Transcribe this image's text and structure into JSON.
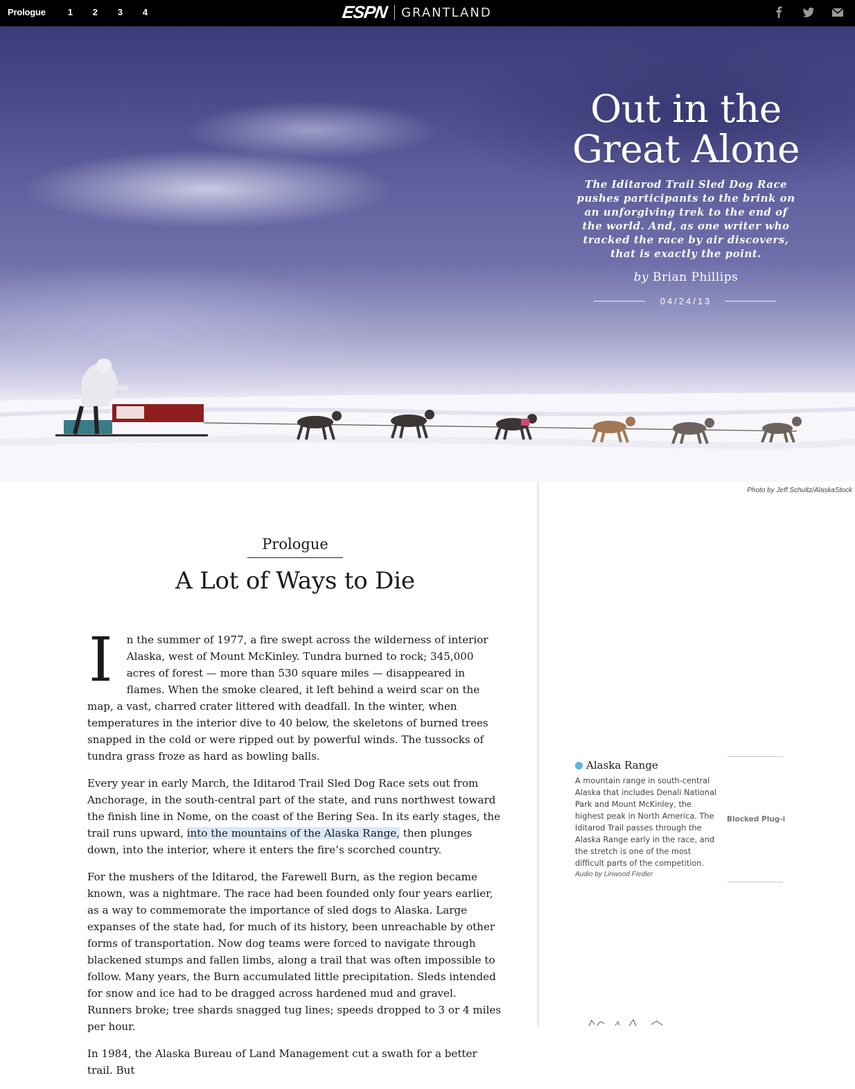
{
  "nav": {
    "chapters": [
      "Prologue",
      "1",
      "2",
      "3",
      "4"
    ],
    "brand_espn": "ESPN",
    "brand_grantland": "GRANTLAND",
    "share_icons": [
      "facebook-icon",
      "twitter-icon",
      "email-icon"
    ]
  },
  "hero": {
    "title_line1": "Out in the",
    "title_line2": "Great Alone",
    "dek": "The Iditarod Trail Sled Dog Race pushes participants to the brink on an unforgiving trek to the end of the world. And, as one writer who tracked the race by air discovers, that is exactly the point.",
    "byline_prefix": "by",
    "author": "Brian Phillips",
    "date": "04/24/13",
    "photo_credit": "Photo by Jeff Schultz/AlaskaStock"
  },
  "article": {
    "kicker": "Prologue",
    "headline": "A Lot of Ways to Die",
    "dropcap": "I",
    "p1": "n the summer of 1977, a fire swept across the wilderness of interior Alaska, west of Mount McKinley. Tundra burned to rock; 345,000 acres of forest — more than 530 square miles — disappeared in flames. When the smoke cleared, it left behind a weird scar on the map, a vast, charred crater littered with deadfall. In the winter, when temperatures in the interior dive to 40 below, the skeletons of burned trees snapped in the cold or were ripped out by powerful winds. The tussocks of tundra grass froze as hard as bowling balls.",
    "p2_before": "Every year in early March, the Iditarod Trail Sled Dog Race sets out from Anchorage, in the south-central part of the state, and runs northwest toward the finish line in Nome, on the coast of the Bering Sea. In its early stages, the trail runs upward, ",
    "p2_link": "into the mountains of the Alaska Range,",
    "p2_after": " then plunges down, into the interior, where it enters the fire’s scorched country.",
    "p3": "For the mushers of the Iditarod, the Farewell Burn, as the region became known, was a nightmare. The race had been founded only four years earlier, as a way to commemorate the importance of sled dogs to Alaska. Large expanses of the state had, for much of its history, been unreachable by other forms of transportation. Now dog teams were forced to navigate through blackened stumps and fallen limbs, along a trail that was often impossible to follow. Many years, the Burn accumulated little precipitation. Sleds intended for snow and ice had to be dragged across hardened mud and gravel. Runners broke; tree shards snagged tug lines; speeds dropped to 3 or 4 miles per hour.",
    "p4": "In 1984, the Alaska Bureau of Land Management cut a swath for a better trail. But"
  },
  "annotation": {
    "title": "Alaska Range",
    "text": "A mountain range in south-central Alaska that includes Denali National Park and Mount McKinley, the highest peak in North America. The Iditarod Trail passes through the Alaska Range early in the race, and the stretch is one of the most difficult parts of the competition.",
    "audio_credit": "Audio by Linwood Fiedler",
    "dot_color": "#5ab6e8"
  },
  "plugin": {
    "label": "Blocked Plug-i"
  }
}
